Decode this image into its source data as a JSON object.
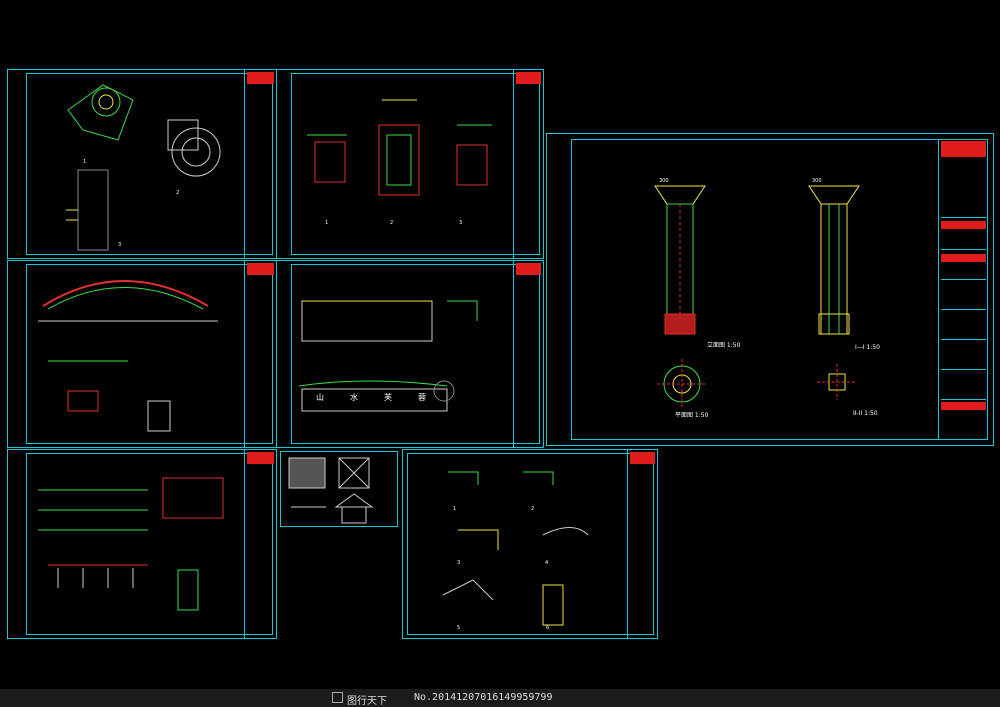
{
  "colors": {
    "background": "#000000",
    "frame": "#19c6cf",
    "title_logo": "#e01c1c",
    "drawing_green": "#3bd94a",
    "drawing_yellow": "#f4e542",
    "drawing_red": "#e03030",
    "footer_bg": "#1b1b1b"
  },
  "sheets": {
    "s1": {
      "labels": [
        "1",
        "2",
        "3"
      ]
    },
    "s2": {
      "labels": [
        "1",
        "2",
        "3"
      ]
    },
    "s3": {
      "labels": []
    },
    "s4": {
      "labels": []
    },
    "s5": {
      "labels": []
    },
    "s7": {
      "labels": [
        "1",
        "2",
        "3",
        "4",
        "5",
        "6"
      ]
    },
    "main": {
      "elevation_label": "立面图 1:50",
      "section_label": "I—I 1:50",
      "plan_label": "平面图 1:50",
      "section2_label": "II-II 1:50",
      "dim_top_left": "300",
      "dim_top_right": "300"
    }
  },
  "stone_text": [
    "山",
    "水",
    "芙",
    "蓉"
  ],
  "footer": {
    "brand": "图行天下",
    "code": "No.20141207016149959799"
  }
}
